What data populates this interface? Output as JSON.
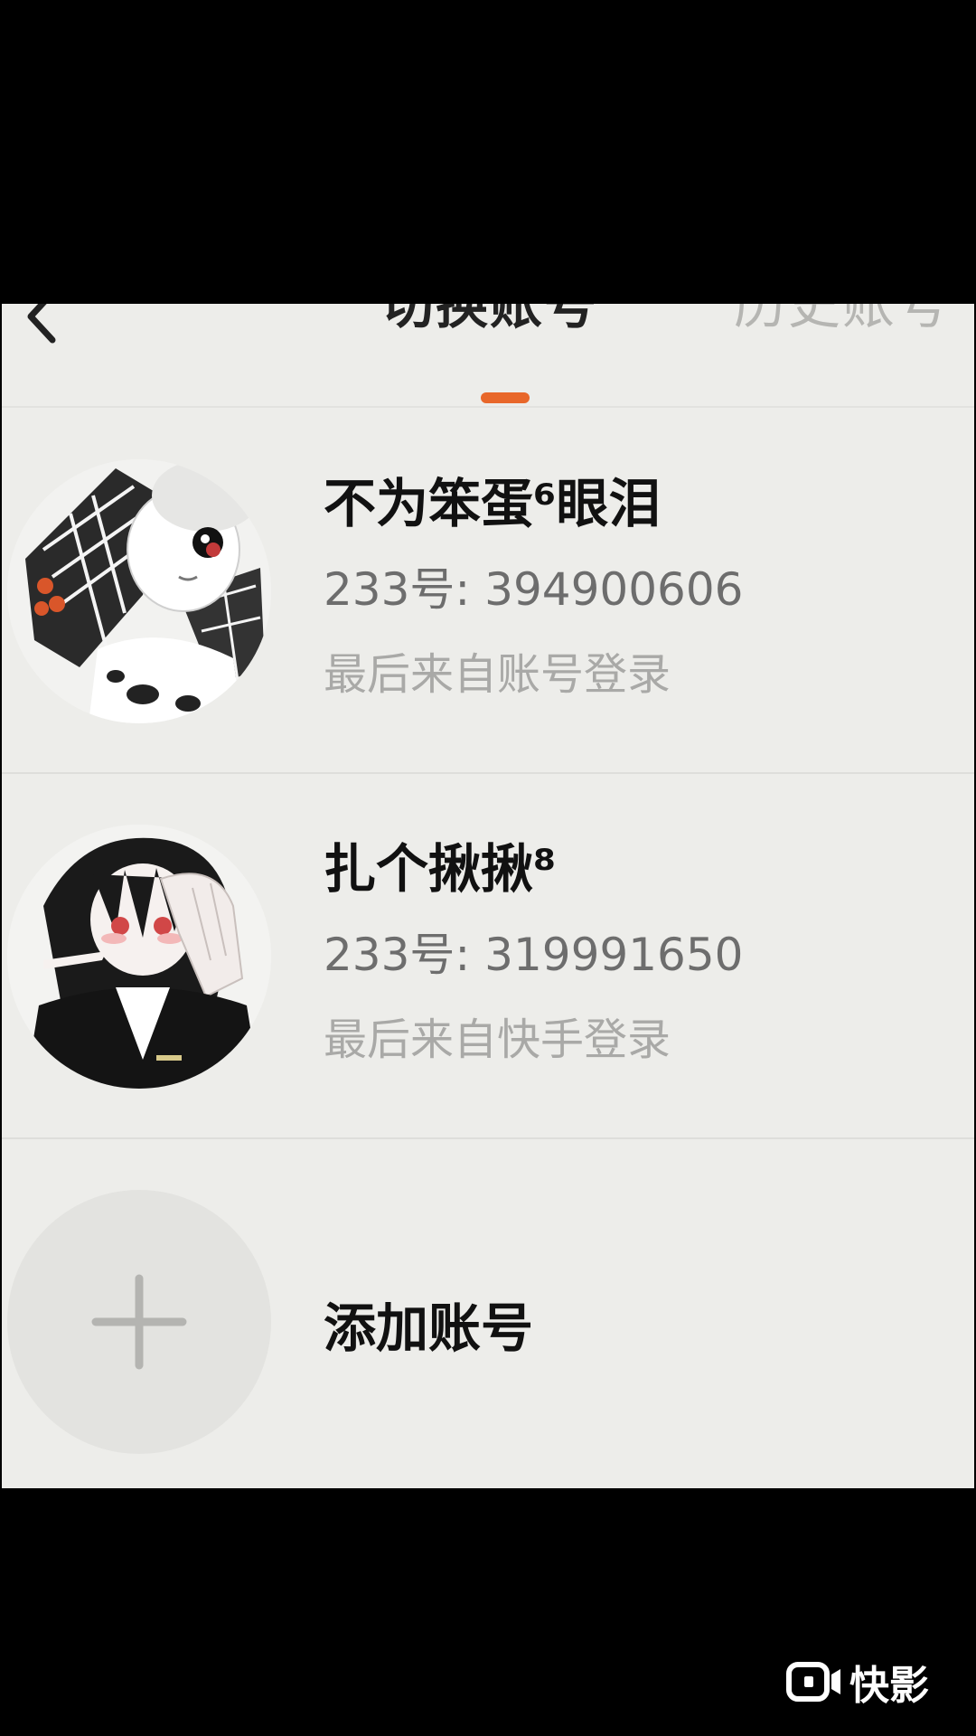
{
  "nav": {
    "tabs": [
      {
        "label": "切换账号",
        "active": true
      },
      {
        "label": "历史账号",
        "active": false
      }
    ],
    "accent_color": "#e8672a"
  },
  "accounts": [
    {
      "name": "不为笨蛋⁶眼泪",
      "id_text": "233号: 394900606",
      "source_text": "最后来自账号登录",
      "avatar": "anime-avatar-plaid-hood"
    },
    {
      "name": "扎个揪揪⁸",
      "id_text": "233号: 319991650",
      "source_text": "最后来自快手登录",
      "avatar": "anime-avatar-black-suit"
    }
  ],
  "add_account": {
    "label": "添加账号",
    "icon": "plus-icon"
  },
  "watermark": {
    "label": "快影",
    "icon": "kuaiying-logo-icon"
  }
}
